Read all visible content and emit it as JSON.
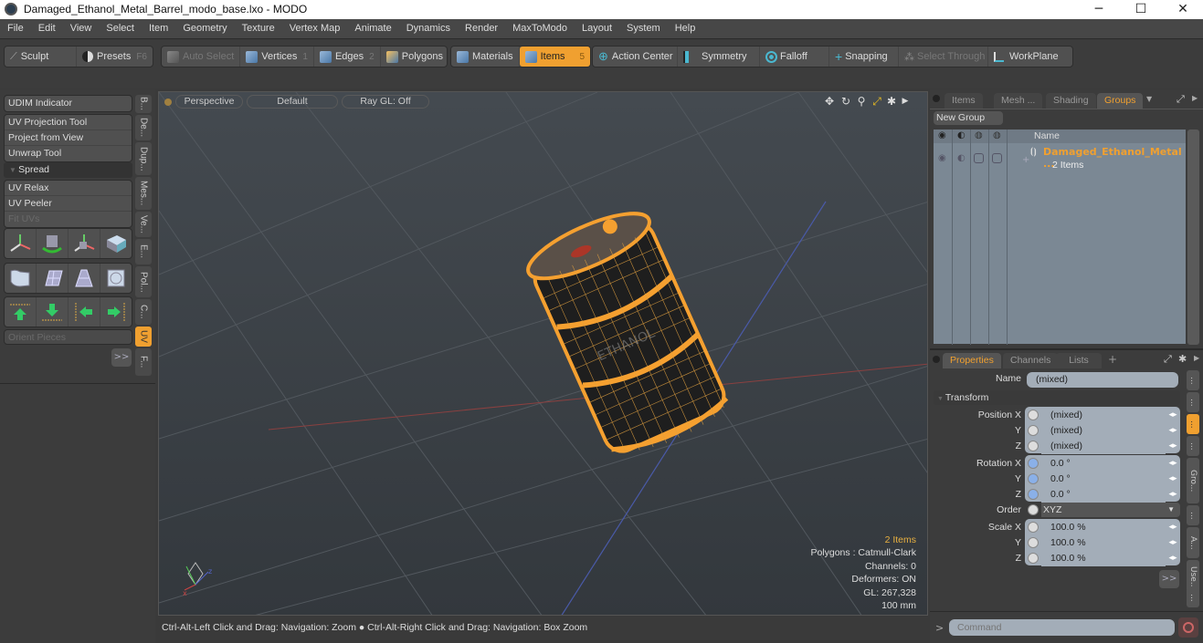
{
  "window": {
    "title": "Damaged_Ethanol_Metal_Barrel_modo_base.lxo - MODO",
    "minimize": "─",
    "maximize": "☐",
    "close": "✕"
  },
  "menu": [
    "File",
    "Edit",
    "View",
    "Select",
    "Item",
    "Geometry",
    "Texture",
    "Vertex Map",
    "Animate",
    "Dynamics",
    "Render",
    "MaxToModo",
    "Layout",
    "System",
    "Help"
  ],
  "toolbar": {
    "sculpt": "Sculpt",
    "presets": "Presets",
    "presets_key": "F6",
    "auto_select": "Auto Select",
    "vertices": "Vertices",
    "vertices_key": "1",
    "edges": "Edges",
    "edges_key": "2",
    "polygons": "Polygons",
    "materials": "Materials",
    "items": "Items",
    "items_key": "5",
    "action_center": "Action Center",
    "symmetry": "Symmetry",
    "falloff": "Falloff",
    "snapping": "Snapping",
    "select_through": "Select Through",
    "workplane": "WorkPlane"
  },
  "left_panel": {
    "udim": "UDIM Indicator",
    "group1": [
      "UV Projection Tool",
      "Project from View",
      "Unwrap Tool"
    ],
    "spread": "Spread",
    "group2": [
      "UV Relax",
      "UV Peeler",
      "Fit UVs"
    ],
    "orient": "Orient Pieces",
    "more": ">>",
    "vtabs": [
      "B...",
      "De...",
      "Dup...",
      "Mes...",
      "Ve...",
      "E...",
      "Pol...",
      "C...",
      "UV",
      "F..."
    ]
  },
  "viewport": {
    "perspective": "Perspective",
    "default": "Default",
    "raygl": "Ray GL: Off",
    "info": {
      "items": "2 Items",
      "polygons": "Polygons : Catmull-Clark",
      "channels": "Channels: 0",
      "deformers": "Deformers: ON",
      "gl": "GL: 267,328",
      "scale": "100 mm"
    },
    "status": "Ctrl-Alt-Left Click and Drag: Navigation: Zoom ● Ctrl-Alt-Right Click and Drag: Navigation: Box Zoom"
  },
  "groups_panel": {
    "tabs": [
      "Items",
      "Mesh ...",
      "Shading",
      "Groups"
    ],
    "active_tab": "Groups",
    "new_group": "New Group",
    "col_name": "Name",
    "row_name": "Damaged_Ethanol_Metal ...",
    "row_sub": "2 Items"
  },
  "properties_panel": {
    "tabs": [
      "Properties",
      "Channels",
      "Lists",
      "+"
    ],
    "active_tab": "Properties",
    "name_label": "Name",
    "name_value": "(mixed)",
    "transform": "Transform",
    "position": {
      "label_x": "Position X",
      "label_y": "Y",
      "label_z": "Z",
      "x": "(mixed)",
      "y": "(mixed)",
      "z": "(mixed)"
    },
    "rotation": {
      "label_x": "Rotation X",
      "label_y": "Y",
      "label_z": "Z",
      "x": "0.0 °",
      "y": "0.0 °",
      "z": "0.0 °"
    },
    "order": {
      "label": "Order",
      "value": "XYZ"
    },
    "scale": {
      "label_x": "Scale X",
      "label_y": "Y",
      "label_z": "Z",
      "x": "100.0 %",
      "y": "100.0 %",
      "z": "100.0 %"
    },
    "more": ">>",
    "side_tabs": [
      "...",
      "...",
      "...",
      "...",
      "Gro...",
      "...",
      "A...",
      "Use...",
      "..."
    ]
  },
  "command": {
    "prompt": ">",
    "placeholder": "Command"
  },
  "colors": {
    "accent": "#f0a030",
    "viewport_bg": "#3d4248",
    "field_bg": "#a3adb8"
  }
}
